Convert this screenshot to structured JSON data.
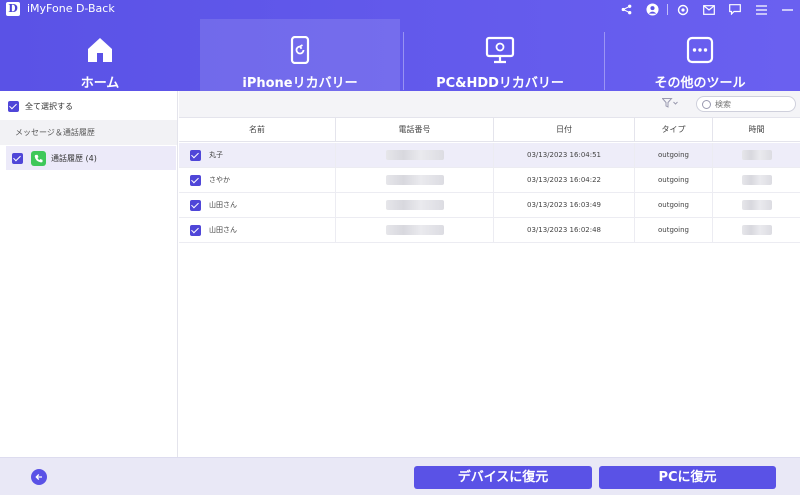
{
  "app": {
    "logo_letter": "D",
    "title": "iMyFone D-Back"
  },
  "titlebar_icons": [
    "share-icon",
    "user-icon",
    "settings-icon",
    "mail-icon",
    "chat-icon",
    "menu-icon",
    "minimize-icon"
  ],
  "nav": {
    "tabs": [
      {
        "label": "ホーム",
        "icon": "home-icon",
        "active": false
      },
      {
        "label": "iPhoneリカバリー",
        "icon": "iphone-recovery-icon",
        "active": true
      },
      {
        "label": "PC&HDDリカバリー",
        "icon": "pc-hdd-icon",
        "active": false
      },
      {
        "label": "その他のツール",
        "icon": "more-tools-icon",
        "active": false
      }
    ]
  },
  "sidebar": {
    "select_all_label": "全て選択する",
    "group_label": "メッセージ＆通話履歴",
    "item_label": "通話履歴 (4)"
  },
  "toolbar": {
    "filter_icon": "filter-icon",
    "search_placeholder": "検索"
  },
  "table": {
    "headers": [
      "名前",
      "電話番号",
      "日付",
      "タイプ",
      "時間"
    ],
    "rows": [
      {
        "name": "丸子",
        "date": "03/13/2023 16:04:51",
        "type": "outgoing"
      },
      {
        "name": "さやか",
        "date": "03/13/2023 16:04:22",
        "type": "outgoing"
      },
      {
        "name": "山田さん",
        "date": "03/13/2023 16:03:49",
        "type": "outgoing"
      },
      {
        "name": "山田さん",
        "date": "03/13/2023 16:02:48",
        "type": "outgoing"
      }
    ]
  },
  "footer": {
    "restore_device_label": "デバイスに復元",
    "restore_pc_label": "PCに復元"
  },
  "colors": {
    "accent": "#5a52e6",
    "highlight_row": "#eeedf9",
    "phone_green": "#3ec85a"
  }
}
